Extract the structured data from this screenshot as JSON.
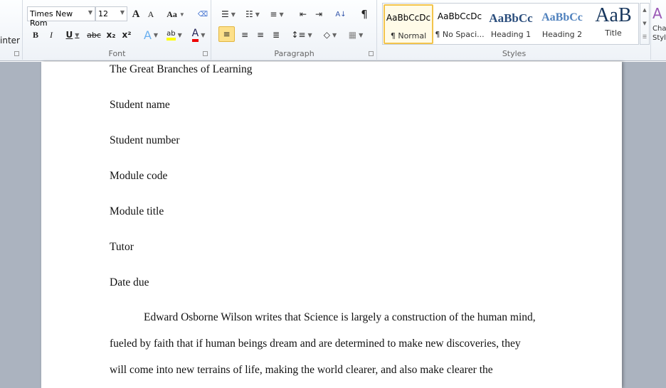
{
  "ribbon": {
    "clipboard": {
      "format_painter_partial": "inter"
    },
    "font": {
      "label": "Font",
      "font_name": "Times New Rom",
      "font_size": "12",
      "bold": "B",
      "italic": "I",
      "underline": "U",
      "strike": "abc",
      "subscript": "x₂",
      "superscript": "x²",
      "change_case": "Aa",
      "grow": "A",
      "shrink": "A",
      "highlight_color": "#ffff00",
      "font_color": "#e00000"
    },
    "paragraph": {
      "label": "Paragraph",
      "pilcrow": "¶",
      "sort": "A↓"
    },
    "styles": {
      "label": "Styles",
      "items": [
        {
          "preview": "AaBbCcDc",
          "name": "¶ Normal",
          "selected": true
        },
        {
          "preview": "AaBbCcDc",
          "name": "¶ No Spaci...",
          "selected": false
        },
        {
          "preview": "AaBbCc",
          "name": "Heading 1",
          "selected": false
        },
        {
          "preview": "AaBbCc",
          "name": "Heading 2",
          "selected": false
        },
        {
          "preview": "AaB",
          "name": "Title",
          "selected": false
        }
      ],
      "change_styles_partial": "Cha Styl"
    }
  },
  "document": {
    "lines": [
      "The Great Branches of Learning",
      "Student name",
      "Student number",
      "Module code",
      "Module title",
      "Tutor",
      "Date due",
      "Edward Osborne Wilson writes that Science is largely a construction of the human mind,",
      "fueled by faith that if human beings dream and are determined to make new discoveries, they",
      "will come into new terrains of life, making the world clearer, and also make clearer the"
    ]
  }
}
